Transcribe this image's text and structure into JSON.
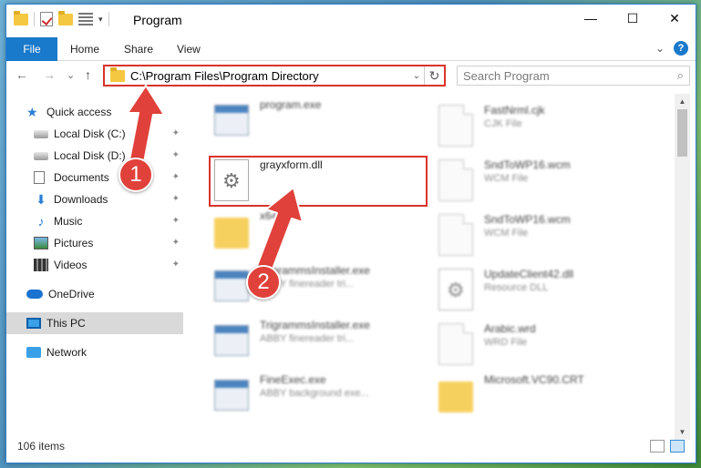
{
  "window": {
    "title": "Program",
    "controls": {
      "minimize": "—",
      "maximize": "☐",
      "close": "✕"
    }
  },
  "ribbon": {
    "tabs": [
      "File",
      "Home",
      "Share",
      "View"
    ],
    "expand_glyph": "⌄",
    "help_glyph": "?"
  },
  "nav": {
    "back_glyph": "←",
    "forward_glyph": "→",
    "history_glyph": "⌄",
    "up_glyph": "↑",
    "address": "C:\\Program Files\\Program Directory",
    "address_dropdown_glyph": "⌄",
    "refresh_glyph": "↻",
    "search_placeholder": "Search Program",
    "search_icon_glyph": "⌕"
  },
  "sidebar": {
    "items": [
      {
        "label": "Quick access",
        "icon": "star-icon",
        "pinned": false
      },
      {
        "label": "Local Disk (C:)",
        "icon": "drive-icon",
        "pinned": true
      },
      {
        "label": "Local Disk (D:)",
        "icon": "drive-icon",
        "pinned": true
      },
      {
        "label": "Documents",
        "icon": "documents-icon",
        "pinned": true
      },
      {
        "label": "Downloads",
        "icon": "download-icon",
        "pinned": true
      },
      {
        "label": "Music",
        "icon": "music-icon",
        "pinned": true
      },
      {
        "label": "Pictures",
        "icon": "pictures-icon",
        "pinned": true
      },
      {
        "label": "Videos",
        "icon": "videos-icon",
        "pinned": true
      },
      {
        "label": "OneDrive",
        "icon": "onedrive-icon",
        "pinned": false
      },
      {
        "label": "This PC",
        "icon": "this-pc-icon",
        "pinned": false,
        "selected": true
      },
      {
        "label": "Network",
        "icon": "network-icon",
        "pinned": false
      }
    ],
    "pin_glyph": "📌"
  },
  "files": {
    "left": [
      {
        "name": "program.exe",
        "type": "",
        "icon": "exe-icon",
        "blurred": true
      },
      {
        "name": "grayxform.dll",
        "type": "",
        "icon": "gear-file-icon",
        "blurred": false
      },
      {
        "name": "x64",
        "type": "",
        "icon": "folder-icon",
        "blurred": true
      },
      {
        "name": "TrigrammsInstaller.exe",
        "type": "ABBY finereader tri...",
        "icon": "exe-icon",
        "blurred": true
      },
      {
        "name": "TrigrammsInstaller.exe",
        "type": "ABBY finereader tri...",
        "icon": "exe-icon",
        "blurred": true
      },
      {
        "name": "FineExec.exe",
        "type": "ABBY background exe...",
        "icon": "exe-icon",
        "blurred": true
      }
    ],
    "right": [
      {
        "name": "FastNrml.cjk",
        "type": "CJK File",
        "icon": "file-icon",
        "blurred": true
      },
      {
        "name": "SndToWP16.wcm",
        "type": "WCM File",
        "icon": "file-icon",
        "blurred": true
      },
      {
        "name": "SndToWP16.wcm",
        "type": "WCM File",
        "icon": "file-icon",
        "blurred": true
      },
      {
        "name": "UpdateClient42.dll",
        "type": "Resource DLL",
        "icon": "gear-file-icon",
        "blurred": true
      },
      {
        "name": "Arabic.wrd",
        "type": "WRD File",
        "icon": "file-icon",
        "blurred": true
      },
      {
        "name": "Microsoft.VC90.CRT",
        "type": "",
        "icon": "folder-icon",
        "blurred": true
      }
    ]
  },
  "scrollbar": {
    "up_glyph": "▲",
    "down_glyph": "▼"
  },
  "status": {
    "item_count": "106 items"
  },
  "annotations": {
    "step1": "1",
    "step2": "2",
    "color": "#e0413a"
  }
}
